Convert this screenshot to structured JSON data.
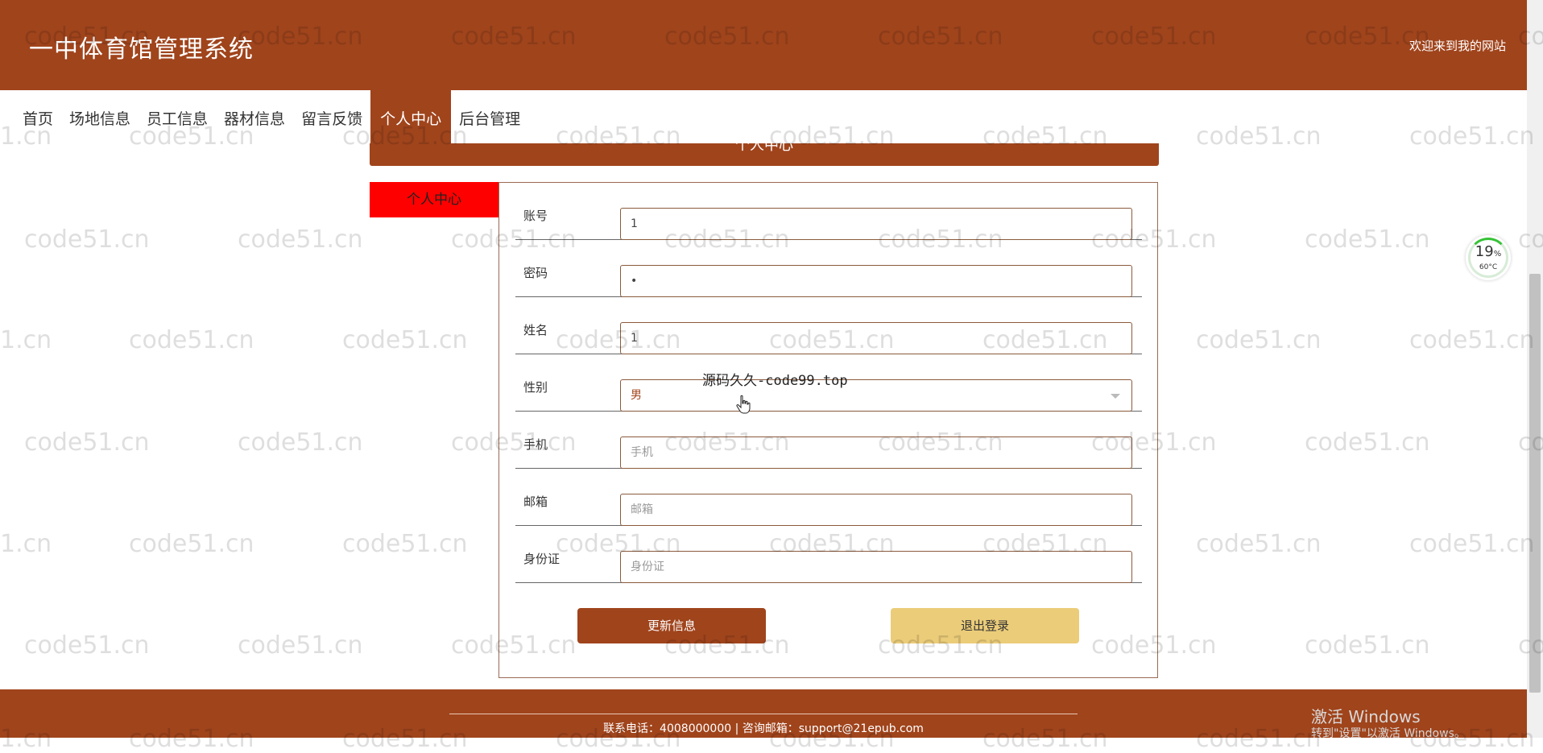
{
  "header": {
    "title": "一中体育馆管理系统",
    "welcome": "欢迎来到我的网站"
  },
  "nav": {
    "items": [
      {
        "label": "首页",
        "active": false
      },
      {
        "label": "场地信息",
        "active": false
      },
      {
        "label": "员工信息",
        "active": false
      },
      {
        "label": "器材信息",
        "active": false
      },
      {
        "label": "留言反馈",
        "active": false
      },
      {
        "label": "个人中心",
        "active": true
      },
      {
        "label": "后台管理",
        "active": false
      }
    ]
  },
  "banner": {
    "title": "个人中心"
  },
  "side_tab": {
    "label": "个人中心"
  },
  "form": {
    "account": {
      "label": "账号",
      "value": "1"
    },
    "password": {
      "label": "密码",
      "value": "•"
    },
    "name": {
      "label": "姓名",
      "value": "1"
    },
    "gender": {
      "label": "性别",
      "value": "男"
    },
    "phone": {
      "label": "手机",
      "placeholder": "手机"
    },
    "email": {
      "label": "邮箱",
      "placeholder": "邮箱"
    },
    "id_card": {
      "label": "身份证",
      "placeholder": "身份证"
    }
  },
  "buttons": {
    "update": "更新信息",
    "logout": "退出登录"
  },
  "footer": {
    "contact": "联系电话：4008000000 | 咨询邮箱：support@21epub.com"
  },
  "overlay": {
    "text": "源码久久-code99.top"
  },
  "watermark": {
    "text": "code51.cn",
    "partial": "1.cn"
  },
  "system": {
    "gauge_percent": "19",
    "gauge_unit": "%",
    "gauge_temp": "60°C",
    "windows_mark": "激活 Windows",
    "windows_sub": "转到\"设置\"以激活 Windows。"
  },
  "colors": {
    "brand": "#a0441c",
    "side_tab": "#ff0000",
    "logout": "#ebcc79"
  }
}
